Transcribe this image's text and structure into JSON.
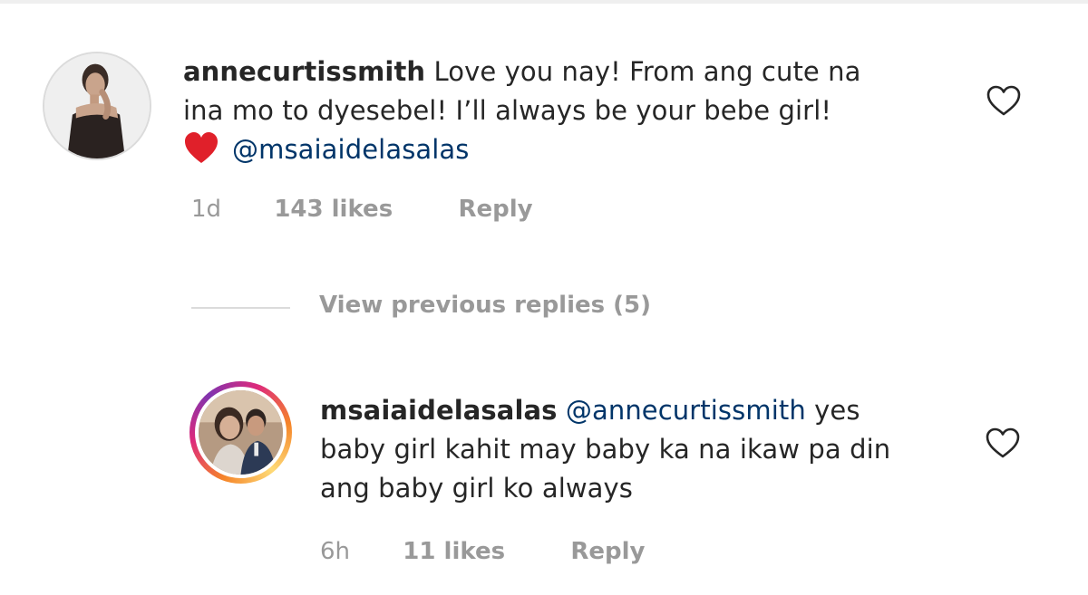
{
  "comments": [
    {
      "username": "annecurtissmith",
      "text_line1": "Love you nay! From ang cute na",
      "text_line2": "ina mo to dyesebel! I’ll always be your bebe girl!",
      "mention": "@msaiaidelasalas",
      "emoji": "red-heart-icon",
      "time": "1d",
      "likes": "143 likes",
      "reply_label": "Reply"
    },
    {
      "username": "msaiaidelasalas",
      "mention": "@annecurtissmith",
      "text_line1": "yes",
      "text_line2": "baby girl kahit may baby ka na ikaw pa din",
      "text_line3": "ang baby girl ko always",
      "time": "6h",
      "likes": "11 likes",
      "reply_label": "Reply"
    }
  ],
  "view_replies": "View previous replies (5)",
  "colors": {
    "text": "#262626",
    "meta": "#999999",
    "mention": "#003569",
    "divider": "#dbdbdb",
    "heart_emoji": "#e0202a"
  }
}
